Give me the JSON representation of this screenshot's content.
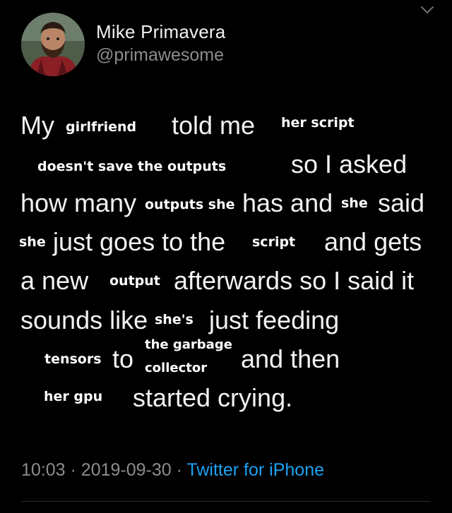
{
  "author": {
    "name": "Mike Primavera",
    "handle": "@primawesome"
  },
  "tweet": {
    "words": [
      "My",
      "girlfriend",
      "told me",
      "her script",
      "doesn't save the outputs",
      "so I asked",
      "how many",
      "outputs she",
      "has and",
      "she",
      "said",
      "she",
      "just goes to the",
      "script",
      "and gets",
      "a new",
      "output",
      "afterwards so I said it",
      "sounds like",
      "she's",
      "just feeding",
      "tensors",
      "to",
      "the garbage",
      "collector",
      "and then",
      "her gpu",
      "started crying."
    ]
  },
  "meta": {
    "time": "10:03",
    "separator": "·",
    "date": "2019-09-30",
    "source": "Twitter for iPhone"
  },
  "colors": {
    "background": "#000000",
    "text": "#f2f2f2",
    "muted": "#8c8c8c",
    "link": "#1da1f2"
  }
}
